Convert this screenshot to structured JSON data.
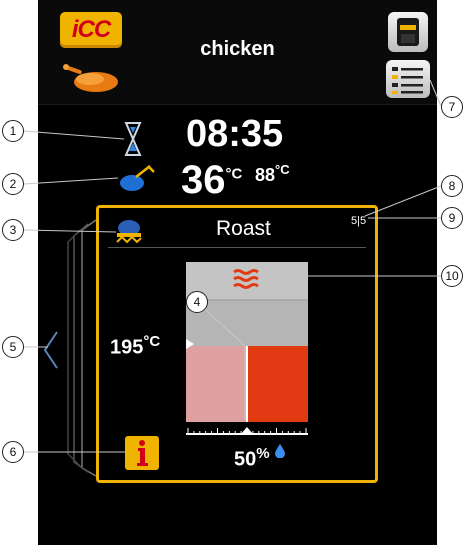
{
  "header": {
    "title": "chicken",
    "logo_text": "iCC",
    "icons": [
      "icc-logo",
      "chicken-icon",
      "cup-icon",
      "list-icon"
    ]
  },
  "status": {
    "time": "08:35",
    "core_temp": "36",
    "core_unit": "°C",
    "set_temp": "88",
    "set_unit": "°C"
  },
  "step": {
    "mode": "Roast",
    "counter": "5|5",
    "cabinet_temp": "195",
    "cabinet_unit": "°C",
    "humidity": "50",
    "humidity_unit": "%",
    "humidity_level": 0.5
  },
  "callouts": [
    "1",
    "2",
    "3",
    "4",
    "5",
    "6",
    "7",
    "8",
    "9",
    "10"
  ],
  "colors": {
    "accent": "#f0b400",
    "heat": "#e23a12",
    "background": "#000000"
  }
}
